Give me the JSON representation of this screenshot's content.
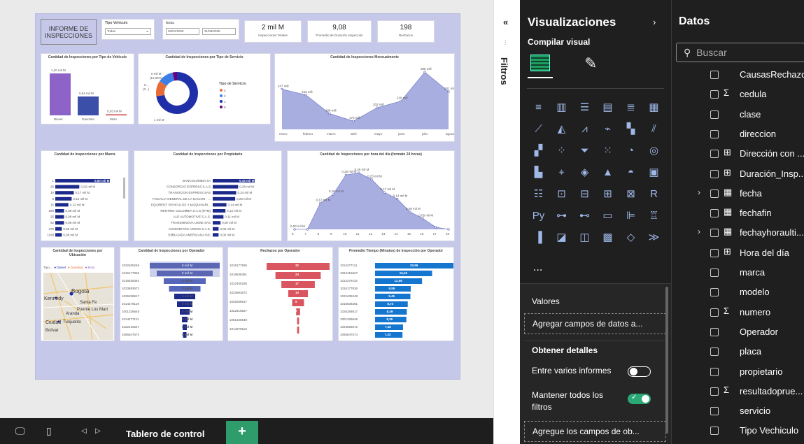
{
  "report": {
    "header_title": "INFORME DE INSPECCIONES",
    "vehicle_type_label": "Tipo Vehículo",
    "vehicle_type_value": "Todas",
    "date_label": "fecha",
    "date_from": "02/01/2025",
    "date_to": "31/08/2025",
    "kpis": [
      {
        "value": "2 mil M",
        "label": "Inspecciones Totales"
      },
      {
        "value": "9,08",
        "label": "Promedio de Duración Inspección"
      },
      {
        "value": "198",
        "label": "Rechazos"
      }
    ],
    "charts": {
      "by_vehicle": {
        "title": "Cantidad de Inspecciones por Tipo de Vehículo",
        "chart_data": {
          "type": "bar",
          "categories": [
            "Diesel",
            "Gasolina",
            "Moto"
          ],
          "labels": [
            "1,20 mil M",
            "0,54 mil M",
            "0,03 mil M"
          ],
          "values": [
            1.2,
            0.54,
            0.03
          ]
        }
      },
      "by_service": {
        "title": "Cantidad de Inspecciones por Tipo de Servicio",
        "legend_title": "Tipo de Servicio",
        "legend": [
          "3",
          "2",
          "1",
          "0"
        ],
        "labels": [
          "0 mil M",
          "(12,05%)",
          "0...",
          "(3...)",
          "1 mil M",
          "(72,5%)"
        ],
        "chart_data": {
          "type": "pie",
          "values": [
            72.5,
            12.05,
            12.0,
            3.45
          ],
          "colors": [
            "#1f2fa8",
            "#e66c37",
            "#3a7ee6",
            "#6b007b"
          ]
        }
      },
      "monthly": {
        "title": "Cantidad de Inspecciones Mensualmente",
        "chart_data": {
          "type": "area",
          "categories": [
            "enero",
            "febrero",
            "marzo",
            "abril",
            "mayo",
            "junio",
            "julio",
            "agosto"
          ],
          "values": [
            247,
            233,
            188,
            170,
            202,
            218,
            288,
            241
          ],
          "labels": [
            "247 mill",
            "233 mill",
            "188 mill",
            "170 mill",
            "202 mill",
            "218 mill",
            "288 mill",
            "241 mill"
          ]
        }
      },
      "by_brand": {
        "title": "Cantidad de Inspecciones por Marca",
        "rows": [
          {
            "cat": "1",
            "label": "0,50 mil M",
            "v": 0.5
          },
          {
            "cat": "26",
            "label": "0,22 mil M",
            "v": 0.22
          },
          {
            "cat": "30",
            "label": "0,17 mil M",
            "v": 0.17
          },
          {
            "cat": "8",
            "label": "0,15 mil M",
            "v": 0.15
          },
          {
            "cat": "15",
            "label": "0,12 mil M",
            "v": 0.12
          },
          {
            "cat": "289",
            "label": "0,08 mil M",
            "v": 0.08
          },
          {
            "cat": "25",
            "label": "0,08 mil M",
            "v": 0.08
          },
          {
            "cat": "62",
            "label": "0,08 mil M",
            "v": 0.08
          },
          {
            "cat": "375",
            "label": "0,06 mil M",
            "v": 0.06
          },
          {
            "cat": "1198",
            "label": "0,06 mil M",
            "v": 0.06
          }
        ]
      },
      "by_owner": {
        "title": "Cantidad de Inspecciones por Propietario",
        "rows": [
          {
            "cat": "BANCOLOMBIA SA",
            "label": "0,43 mil M",
            "v": 0.43
          },
          {
            "cat": "CONSORCIO EXPRESS S.A.S",
            "label": "0,26 mil M",
            "v": 0.26
          },
          {
            "cat": "TRANSICION EXPRESS SAS",
            "label": "0,24 mil M",
            "v": 0.24
          },
          {
            "cat": "FISCALIA GENERAL DE LA NACION - ...",
            "label": "0,23 mil M",
            "v": 0.23
          },
          {
            "cat": "EQUIRENT VEHICULOS Y MAQUINARI...",
            "label": "0,14 mil M",
            "v": 0.14
          },
          {
            "cat": "RENTING COLOMBIA S.A.S (RTM)",
            "label": "0,13 mil M",
            "v": 0.13
          },
          {
            "cat": "ALD AUTOMOTIVE S.A.S.",
            "label": "0,11 mil M",
            "v": 0.11
          },
          {
            "cat": "TRANSMINOVA USME SAS",
            "label": "0,08 mil M",
            "v": 0.08
          },
          {
            "cat": "CONCRETOS ARGOS S.A.S.",
            "label": "0,06 mil M",
            "v": 0.06
          },
          {
            "cat": "EMBAJADA AMERICANA INC",
            "label": "0,06 mil M",
            "v": 0.06
          }
        ]
      },
      "by_hour": {
        "title": "Cantidad de Inspecciones por hora del día (formato 24 horas)",
        "chart_data": {
          "type": "area",
          "categories": [
            "6",
            "7",
            "8",
            "9",
            "10",
            "11",
            "12",
            "13",
            "14",
            "15",
            "16",
            "17",
            "18"
          ],
          "values": [
            0.0,
            0.0,
            0.12,
            0.16,
            0.25,
            0.26,
            0.23,
            0.17,
            0.14,
            0.08,
            0.05,
            0.01,
            0.0
          ],
          "labels": [
            "0,00 mil M",
            "",
            "0,12 mil M",
            "0,16 mil M",
            "0,25 mil M",
            "0,26 mil M",
            "0,23 mil M",
            "0,17 mil M",
            "0,14 mil M",
            "0,08 mil M",
            "0,05 mil M",
            "",
            ""
          ]
        }
      },
      "location": {
        "title": "Cantidad de Inspecciones por Ubicación",
        "legend": [
          "Tipo...",
          "Diesel",
          "Gasolina",
          "Moto"
        ],
        "places": [
          "Bogotá",
          "Kennedy",
          "Santa Fe",
          "Puente Los Mart",
          "Aranda",
          "Ciudad",
          "Tunjuelito",
          "Bolívar"
        ]
      },
      "by_operator": {
        "title": "Cantidad de Inspecciones por Operador",
        "rows": [
          {
            "cat": "1022405246",
            "label": "0 mil M",
            "v": 100
          },
          {
            "cat": "1016177826",
            "label": "0 mil M",
            "v": 80
          },
          {
            "cat": "1016838391",
            "label": "0 mil M",
            "v": 60
          },
          {
            "cat": "1023693572",
            "label": "0 mil M",
            "v": 45
          },
          {
            "cat": "1026258617",
            "label": "0 mil M",
            "v": 30
          },
          {
            "cat": "1014279119",
            "label": "0 mil M",
            "v": 22
          },
          {
            "cat": "1001328648",
            "label": "0 mil M",
            "v": 14
          },
          {
            "cat": "1014277111",
            "label": "0 mil M",
            "v": 8
          },
          {
            "cat": "1022416627",
            "label": "0 mil M",
            "v": 6
          },
          {
            "cat": "1065647574",
            "label": "0 mil M",
            "v": 5
          }
        ]
      },
      "rejects_operator": {
        "title": "Rechazos por Operador",
        "rows": [
          {
            "cat": "1016177826",
            "label": "32",
            "v": 32
          },
          {
            "cat": "1016838391",
            "label": "23",
            "v": 23
          },
          {
            "cat": "1022405246",
            "label": "17",
            "v": 17
          },
          {
            "cat": "1023693572",
            "label": "10",
            "v": 10
          },
          {
            "cat": "1026258617",
            "label": "6",
            "v": 6
          },
          {
            "cat": "1022416627",
            "label": "2",
            "v": 2
          },
          {
            "cat": "1001328648",
            "label": "1",
            "v": 1
          },
          {
            "cat": "1014279119",
            "label": "1",
            "v": 1
          }
        ]
      },
      "avg_time": {
        "title": "Promedio Tiempo (Minutos) de Inspección por Operador",
        "rows": [
          {
            "cat": "1014277111",
            "label": "20,96",
            "v": 20.96
          },
          {
            "cat": "1022416627",
            "label": "15,26",
            "v": 15.26
          },
          {
            "cat": "1014279119",
            "label": "12,56",
            "v": 12.56
          },
          {
            "cat": "1016177826",
            "label": "9,55",
            "v": 9.55
          },
          {
            "cat": "1022405248",
            "label": "9,45",
            "v": 9.45
          },
          {
            "cat": "1016838391",
            "label": "8,74",
            "v": 8.74
          },
          {
            "cat": "1026258617",
            "label": "8,49",
            "v": 8.49
          },
          {
            "cat": "1001328648",
            "label": "8,36",
            "v": 8.36
          },
          {
            "cat": "1023693572",
            "label": "7,48",
            "v": 7.48
          },
          {
            "cat": "1065647574",
            "label": "7,33",
            "v": 7.33
          }
        ]
      }
    }
  },
  "bottom": {
    "page_tab": "Tablero de control",
    "add_label": "+"
  },
  "filtros": {
    "label": "Filtros"
  },
  "viz": {
    "title": "Visualizaciones",
    "build_label": "Compilar visual",
    "more": "...",
    "values_label": "Valores",
    "values_drop": "Agregar campos de datos a...",
    "drill_label": "Obtener detalles",
    "cross_report": "Entre varios informes",
    "keep_filters": "Mantener todos los filtros",
    "drill_drop": "Agregue los campos de ob..."
  },
  "data": {
    "title": "Datos",
    "search_placeholder": "Buscar",
    "fields": [
      {
        "name": "CausasRechazo",
        "sigma": "",
        "icon": "",
        "exp": ""
      },
      {
        "name": "cedula",
        "sigma": "Σ",
        "icon": "",
        "exp": ""
      },
      {
        "name": "clase",
        "sigma": "",
        "icon": "",
        "exp": ""
      },
      {
        "name": "direccion",
        "sigma": "",
        "icon": "",
        "exp": ""
      },
      {
        "name": "Dirección con ...",
        "sigma": "",
        "icon": "⊞",
        "exp": ""
      },
      {
        "name": "Duración_Insp...",
        "sigma": "",
        "icon": "⊞",
        "exp": ""
      },
      {
        "name": "fecha",
        "sigma": "",
        "icon": "▦",
        "exp": "›"
      },
      {
        "name": "fechafin",
        "sigma": "",
        "icon": "▦",
        "exp": ""
      },
      {
        "name": "fechayhoraulti...",
        "sigma": "",
        "icon": "▦",
        "exp": "›"
      },
      {
        "name": "Hora del día",
        "sigma": "",
        "icon": "⊞",
        "exp": ""
      },
      {
        "name": "marca",
        "sigma": "",
        "icon": "",
        "exp": ""
      },
      {
        "name": "modelo",
        "sigma": "",
        "icon": "",
        "exp": ""
      },
      {
        "name": "numero",
        "sigma": "Σ",
        "icon": "",
        "exp": ""
      },
      {
        "name": "Operador",
        "sigma": "",
        "icon": "",
        "exp": ""
      },
      {
        "name": "placa",
        "sigma": "",
        "icon": "",
        "exp": ""
      },
      {
        "name": "propietario",
        "sigma": "",
        "icon": "",
        "exp": ""
      },
      {
        "name": "resultadoprue...",
        "sigma": "Σ",
        "icon": "",
        "exp": ""
      },
      {
        "name": "servicio",
        "sigma": "",
        "icon": "",
        "exp": ""
      },
      {
        "name": "Tipo Vechiculo",
        "sigma": "",
        "icon": "",
        "exp": ""
      }
    ]
  }
}
